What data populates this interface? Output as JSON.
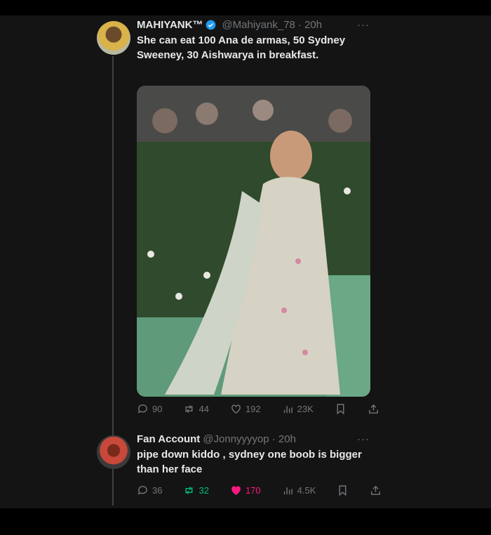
{
  "tweet1": {
    "name": "MAHIYANK™",
    "handle": "@Mahiyank_78",
    "time": "· 20h",
    "more": "···",
    "text": "She can eat 100 Ana de armas, 50 Sydney Sweeney, 30 Aishwarya in breakfast.",
    "replies": "90",
    "retweets": "44",
    "likes": "192",
    "views": "23K"
  },
  "tweet2": {
    "name": "Fan Account",
    "handle": "@Jonnyyyyop",
    "time": "· 20h",
    "more": "···",
    "text": "pipe down kiddo , sydney one boob is bigger than her face",
    "replies": "36",
    "retweets": "32",
    "likes": "170",
    "views": "4.5K"
  },
  "colors": {
    "verified": "#1d9bf0",
    "retweet_active": "#00ba7c",
    "like_active": "#f91880"
  },
  "icons": [
    "verified-badge-icon",
    "reply-icon",
    "retweet-icon",
    "like-icon",
    "views-icon",
    "bookmark-icon",
    "share-icon",
    "more-icon"
  ]
}
